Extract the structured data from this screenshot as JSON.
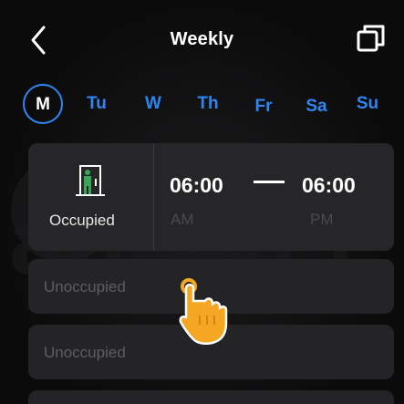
{
  "header": {
    "title": "Weekly",
    "icons": [
      "back-chevron-icon",
      "copy-icon"
    ]
  },
  "days": {
    "items": [
      "M",
      "Tu",
      "W",
      "Th",
      "Fr",
      "Sa",
      "Su"
    ],
    "selected": "M"
  },
  "schedule": {
    "current": {
      "mode_label": "Occupied",
      "mode_icon": "occupied-person-icon",
      "start_time": "06:00",
      "start_period": "AM",
      "separator": "—",
      "end_time": "06:00",
      "end_period": "PM"
    },
    "slots": [
      {
        "label": "Unoccupied"
      },
      {
        "label": "Unoccupied"
      }
    ]
  },
  "watermark": {
    "text": "applyer"
  },
  "colors": {
    "accent": "#2f86f2",
    "card": "#242426",
    "background": "#0b0b0c",
    "occupied_icon": "#3aa655",
    "cursor_hand": "#f5a623"
  }
}
